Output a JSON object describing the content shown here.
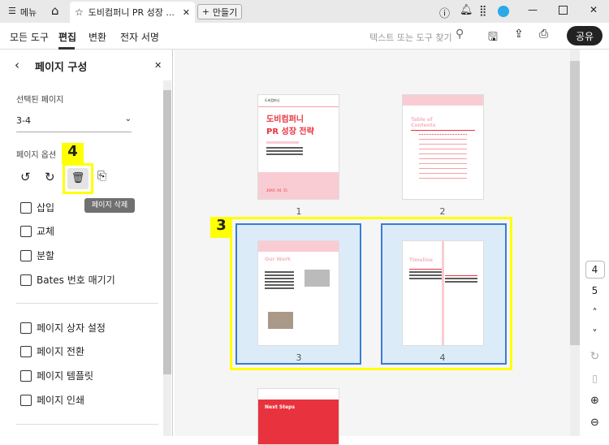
{
  "tabbar": {
    "menu": "메뉴",
    "tab_title": "도비컴퍼니 PR 성장 ...",
    "new_button": "만들기"
  },
  "toolbar": {
    "menus": [
      "모든 도구",
      "편집",
      "변환",
      "전자 서명"
    ],
    "search_placeholder": "텍스트 또는 도구 찾기",
    "share": "공유"
  },
  "panel": {
    "title": "페이지 구성",
    "selected_label": "선택된 페이지",
    "selected_value": "3-4",
    "options_label": "페이지 옵션",
    "tooltip": "페이지 삭제",
    "step4": "4",
    "items": [
      "삽입",
      "교체",
      "분할",
      "Bates 번호 매기기"
    ],
    "items2": [
      "페이지 상자 설정",
      "페이지 전환",
      "페이지 템플릿",
      "페이지 인쇄"
    ]
  },
  "pages": {
    "p1_logo": "도비컴퍼니",
    "p1_title1": "도비컴퍼니",
    "p1_title2": "PR 성장 전략",
    "p1_date": "20XX. 04. 15",
    "p2_title": "Table of Contents",
    "p3_title": "Our Work",
    "p4_title": "Timeline",
    "p5_title": "Next Steps",
    "labels": [
      "1",
      "2",
      "3",
      "4"
    ],
    "step3": "3"
  },
  "rail": {
    "page_current": "4",
    "page_total": "5"
  },
  "colors": {
    "highlight": "#ffff00",
    "selection": "#3a7bd5",
    "accent": "#e8333e"
  }
}
